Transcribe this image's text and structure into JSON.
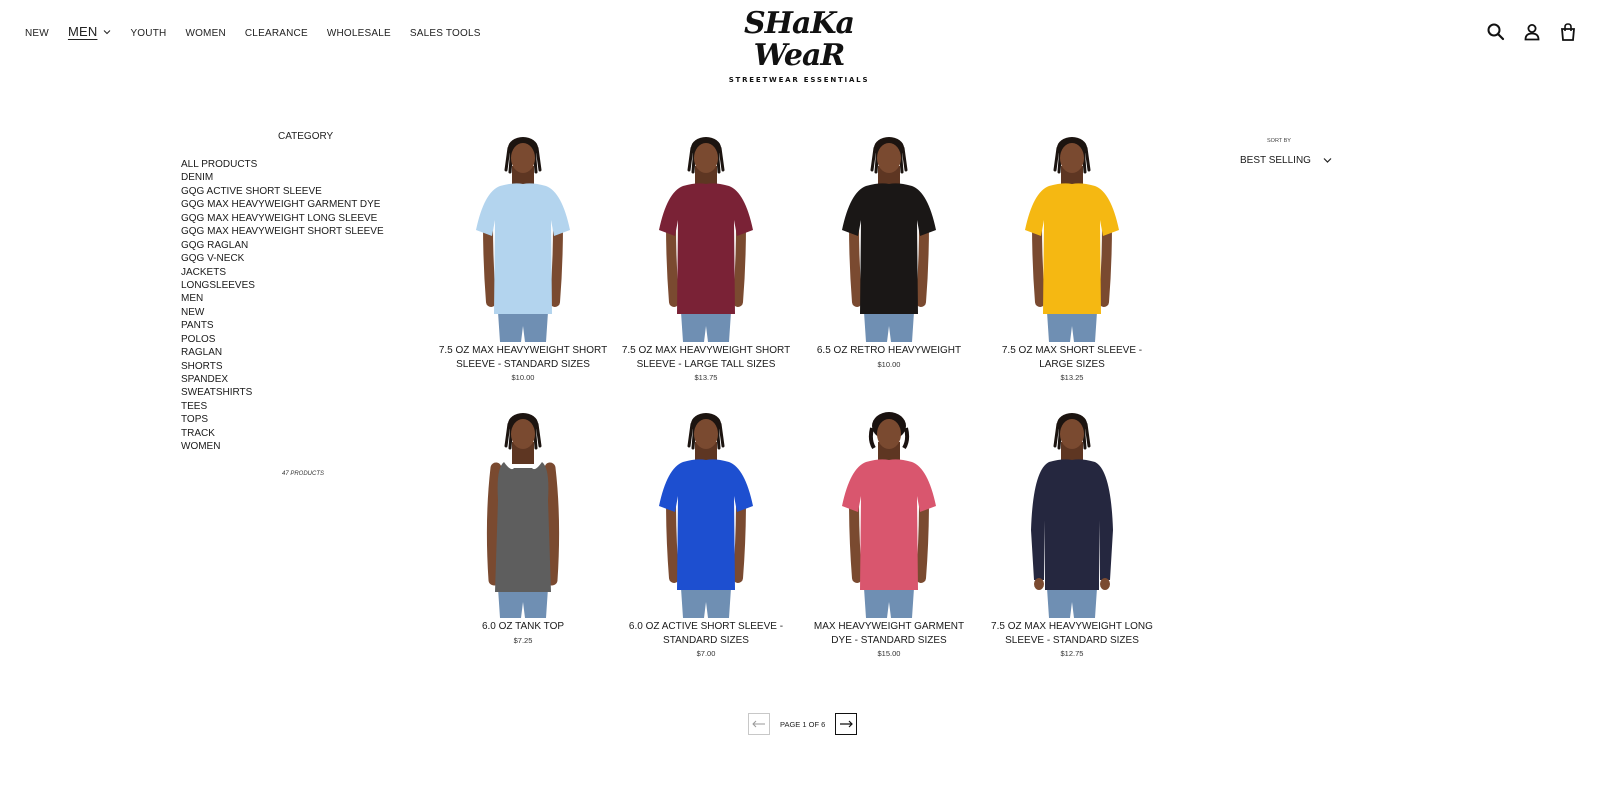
{
  "nav": {
    "items": [
      "NEW",
      "MEN",
      "YOUTH",
      "WOMEN",
      "CLEARANCE",
      "WHOLESALE",
      "SALES TOOLS"
    ]
  },
  "logo": {
    "main": "SHaKa WeaR",
    "tagline": "STREETWEAR ESSENTIALS"
  },
  "icons": {
    "search": "search-icon",
    "account": "account-icon",
    "cart": "cart-icon"
  },
  "sidebar": {
    "title": "CATEGORY",
    "categories": [
      "ALL PRODUCTS",
      "DENIM",
      "GQG ACTIVE SHORT SLEEVE",
      "GQG MAX HEAVYWEIGHT GARMENT DYE",
      "GQG MAX HEAVYWEIGHT LONG SLEEVE",
      "GQG MAX HEAVYWEIGHT SHORT SLEEVE",
      "GQG RAGLAN",
      "GQG V-NECK",
      "JACKETS",
      "LONGSLEEVES",
      "MEN",
      "NEW",
      "PANTS",
      "POLOS",
      "RAGLAN",
      "SHORTS",
      "SPANDEX",
      "SWEATSHIRTS",
      "TEES",
      "TOPS",
      "TRACK",
      "WOMEN"
    ],
    "product_count": "47 PRODUCTS"
  },
  "sort": {
    "label": "SORT BY",
    "selected": "BEST SELLING"
  },
  "products": [
    {
      "title": "7.5 OZ MAX HEAVYWEIGHT SHORT SLEEVE - STANDARD SIZES",
      "price": "$10.00",
      "color": "#b3d4ee",
      "type": "tee",
      "hair": "dreads"
    },
    {
      "title": "7.5 OZ MAX HEAVYWEIGHT SHORT SLEEVE - LARGE TALL SIZES",
      "price": "$13.75",
      "color": "#7a2236",
      "type": "tee",
      "hair": "dreads"
    },
    {
      "title": "6.5 OZ RETRO HEAVYWEIGHT",
      "price": "$10.00",
      "color": "#1a1716",
      "type": "tee",
      "hair": "dreads"
    },
    {
      "title": "7.5 OZ MAX SHORT SLEEVE - LARGE SIZES",
      "price": "$13.25",
      "color": "#f5b812",
      "type": "tee",
      "hair": "dreads"
    },
    {
      "title": "6.0 OZ TANK TOP",
      "price": "$7.25",
      "color": "#5e5e5e",
      "type": "tank",
      "hair": "dreads"
    },
    {
      "title": "6.0 OZ ACTIVE SHORT SLEEVE - STANDARD SIZES",
      "price": "$7.00",
      "color": "#1d4fd0",
      "type": "tee",
      "hair": "dreads"
    },
    {
      "title": "MAX HEAVYWEIGHT GARMENT DYE - STANDARD SIZES",
      "price": "$15.00",
      "color": "#d9566e",
      "type": "tee",
      "hair": "curly"
    },
    {
      "title": "7.5 OZ MAX HEAVYWEIGHT LONG SLEEVE - STANDARD SIZES",
      "price": "$12.75",
      "color": "#25273f",
      "type": "long",
      "hair": "dreads"
    }
  ],
  "pagination": {
    "text": "PAGE 1 OF 6"
  }
}
